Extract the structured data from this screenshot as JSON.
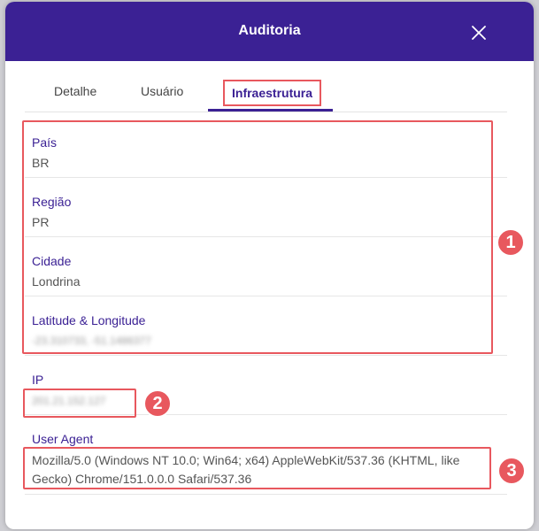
{
  "dialog": {
    "title": "Auditoria"
  },
  "tabs": [
    {
      "label": "Detalhe"
    },
    {
      "label": "Usuário"
    },
    {
      "label": "Infraestrutura"
    }
  ],
  "fields": {
    "pais": {
      "label": "País",
      "value": "BR"
    },
    "regiao": {
      "label": "Região",
      "value": "PR"
    },
    "cidade": {
      "label": "Cidade",
      "value": "Londrina"
    },
    "latlong": {
      "label": "Latitude & Longitude",
      "value": "-23.310733, -51.1486377"
    },
    "ip": {
      "label": "IP",
      "value": "201.21.152.127"
    },
    "user_agent": {
      "label": "User Agent",
      "value": "Mozilla/5.0 (Windows NT 10.0; Win64; x64) AppleWebKit/537.36 (KHTML, like Gecko) Chrome/151.0.0.0 Safari/537.36"
    }
  },
  "annotations": [
    {
      "number": "1"
    },
    {
      "number": "2"
    },
    {
      "number": "3"
    }
  ],
  "colors": {
    "header": "#3b2194",
    "accent": "#3b2194",
    "annotation": "#e8585e"
  },
  "icons": {
    "close": "close-icon"
  }
}
